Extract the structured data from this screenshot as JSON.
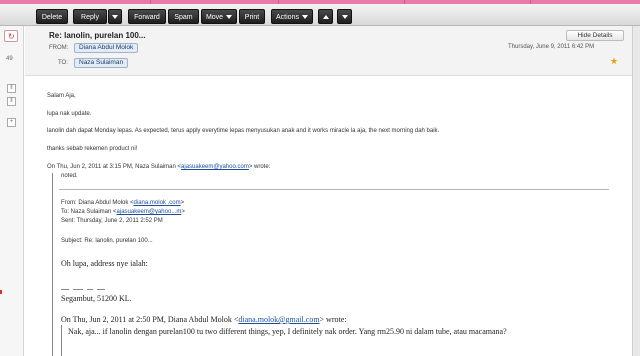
{
  "toolbar": {
    "delete": "Delete",
    "reply": "Reply",
    "forward": "Forward",
    "spam": "Spam",
    "move": "Move",
    "print": "Print",
    "actions": "Actions"
  },
  "rail": {
    "count": "49"
  },
  "message": {
    "subject": "Re: lanolin, purelan 100...",
    "hide_details": "Hide Details",
    "from_label": "FROM:",
    "from_name": "Diana Abdul Molok",
    "to_label": "TO:",
    "to_name": "Naza Sulaiman",
    "date": "Thursday, June 9, 2011 6:42 PM"
  },
  "body": {
    "greeting": "Salam Aja,",
    "line1": "lupa nak update.",
    "line2": "lanolin dah dapat Monday lepas.  As expected, terus apply everytime lepas menyusukan anak and it works miracle la aja, the next morning dah baik.",
    "line3": "thanks sebab rekemen product ni!",
    "quote_prefix": "On Thu, Jun 2, 2011 at 3:15 PM, Naza Sulaiman <",
    "quote_email": "ajasuakeem@yahoo.com",
    "quote_suffix": "> wrote:",
    "noted": "noted."
  },
  "forwarded": {
    "from_prefix": "From: Diana Abdul Molok <",
    "from_email": "diana.molok                .com",
    "from_suffix": ">",
    "to_prefix": "To: Naza Sulaiman <",
    "to_email": "ajasuakeem@yahoo...m",
    "to_suffix": ">",
    "sent": "Sent: Thursday, June 2, 2011 2:52 PM",
    "subject": "Subject: Re: lanolin, purelan 100...",
    "address_intro": "Oh lupa, address nye ialah:",
    "address_last": "Segambut, 51200 KL.",
    "inner_prefix": "On Thu, Jun 2, 2011 at 2:50 PM, Diana Abdul Molok <",
    "inner_email": "diana.molok@gmail.com",
    "inner_suffix": "> wrote:",
    "inner_text": "Nak, aja... if lanolin dengan purelan100 tu two different things, yep,  I definitely nak order.  Yang rm25.90 ni dalam tube, atau macamana?"
  },
  "colors": {
    "accent": "#e97aa6",
    "link": "#1a4e9c",
    "star": "#e5a100"
  }
}
